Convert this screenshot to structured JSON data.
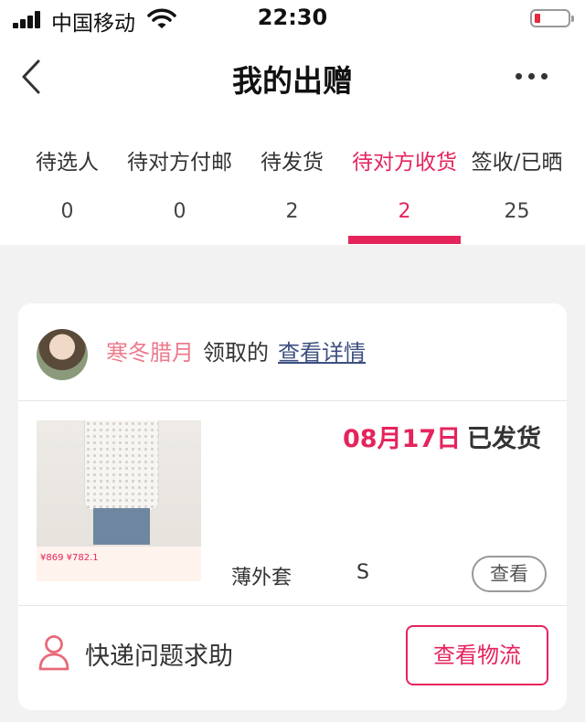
{
  "status_bar": {
    "carrier": "中国移动",
    "time": "22:30"
  },
  "nav": {
    "title": "我的出赠"
  },
  "tabs": [
    {
      "label": "待选人",
      "count": "0"
    },
    {
      "label": "待对方付邮",
      "count": "0"
    },
    {
      "label": "待发货",
      "count": "2"
    },
    {
      "label": "待对方收货",
      "count": "2",
      "active": true
    },
    {
      "label": "签收/已晒",
      "count": "25"
    }
  ],
  "card": {
    "recipient_name": "寒冬腊月",
    "claim_verb": "领取的",
    "detail_link": "查看详情",
    "ship_date": "08月17日",
    "ship_status": "已发货",
    "item_name": "薄外套",
    "item_size": "S",
    "view_button": "查看",
    "thumb_price": "¥869",
    "thumb_price2": "¥782.1",
    "help_text": "快递问题求助",
    "logistics_button": "查看物流"
  },
  "colors": {
    "accent": "#e5245c",
    "nickname": "#ee7a8c",
    "link": "#3e4f80"
  }
}
